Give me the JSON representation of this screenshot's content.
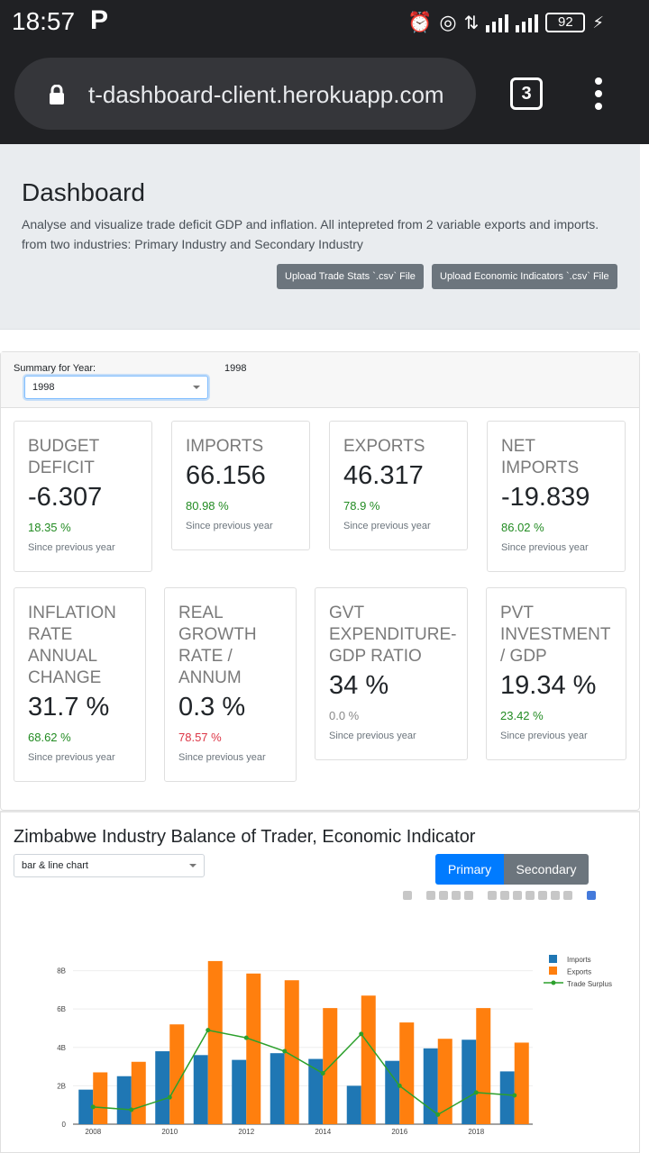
{
  "status": {
    "time": "18:57",
    "battery": "92"
  },
  "browser": {
    "url": "t-dashboard-client.herokuapp.com",
    "tab_count": "3"
  },
  "jumbotron": {
    "title": "Dashboard",
    "description": "Analyse and visualize trade deficit GDP and inflation. All intepreted from 2 variable exports and imports. from two industries: Primary Industry and Secondary Industry",
    "upload_trade": "Upload Trade Stats `.csv` File",
    "upload_econ": "Upload Economic Indicators `.csv` File"
  },
  "summary": {
    "label": "Summary for Year:",
    "year_display": "1998",
    "year_selected": "1998",
    "row1": [
      {
        "title": "BUDGET DEFICIT",
        "value": "-6.307",
        "pct": "18.35 %",
        "note": "Since previous year"
      },
      {
        "title": "IMPORTS",
        "value": "66.156",
        "pct": "80.98 %",
        "note": "Since previous year"
      },
      {
        "title": "EXPORTS",
        "value": "46.317",
        "pct": "78.9 %",
        "note": "Since previous year"
      },
      {
        "title": "NET IMPORTS",
        "value": "-19.839",
        "pct": "86.02 %",
        "note": "Since previous year"
      }
    ],
    "row2": [
      {
        "title": "INFLATION RATE ANNUAL CHANGE",
        "value": "31.7 %",
        "pct": "68.62 %",
        "note": "Since previous year"
      },
      {
        "title": "REAL GROWTH RATE / ANNUM",
        "value": "0.3 %",
        "pct": "78.57 %",
        "note": "Since previous year"
      },
      {
        "title": "GVT EXPENDITURE-GDP RATIO",
        "value": "34 %",
        "pct": "0.0 %",
        "note": "Since previous year"
      },
      {
        "title": "PVT INVESTMENT / GDP",
        "value": "19.34 %",
        "pct": "23.42 %",
        "note": "Since previous year"
      }
    ]
  },
  "chart_section": {
    "title": "Zimbabwe Industry Balance of Trader, Economic Indicator",
    "chart_type_selected": "bar & line chart",
    "primary_label": "Primary",
    "secondary_label": "Secondary"
  },
  "colors": {
    "imports": "#1f77b4",
    "exports": "#ff7f0e",
    "surplus": "#2ca02c",
    "primary": "#007bff",
    "secondary": "#6c757d"
  },
  "chart_data": {
    "type": "bar",
    "categories": [
      2008,
      2009,
      2010,
      2011,
      2012,
      2013,
      2014,
      2015,
      2016,
      2017,
      2018,
      2019
    ],
    "series": [
      {
        "name": "Imports",
        "type": "bar",
        "values": [
          1.8,
          2.5,
          3.8,
          3.6,
          3.35,
          3.7,
          3.4,
          2.0,
          3.3,
          3.95,
          4.4,
          2.75
        ]
      },
      {
        "name": "Exports",
        "type": "bar",
        "values": [
          2.7,
          3.25,
          5.2,
          8.5,
          7.85,
          7.5,
          6.05,
          6.7,
          5.3,
          4.45,
          6.05,
          4.25
        ]
      },
      {
        "name": "Trade Surplus",
        "type": "line",
        "values": [
          0.9,
          0.75,
          1.4,
          4.9,
          4.5,
          3.8,
          2.65,
          4.7,
          2.0,
          0.5,
          1.65,
          1.5
        ]
      }
    ],
    "xticks": [
      "2008",
      "2010",
      "2012",
      "2014",
      "2016",
      "2018"
    ],
    "yticks": [
      "0",
      "2B",
      "4B",
      "6B",
      "8B"
    ],
    "ylim": [
      0,
      9.2
    ],
    "legend": "top-right"
  }
}
